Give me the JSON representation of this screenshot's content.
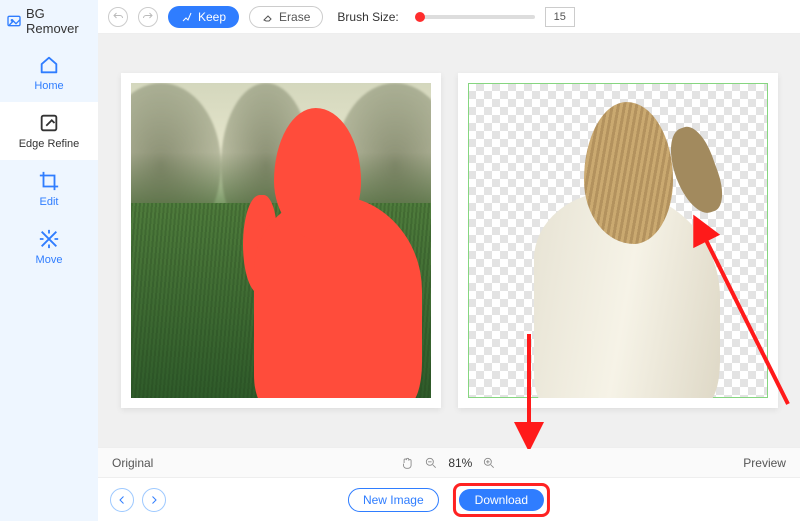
{
  "brand": "BG Remover",
  "sidebar": {
    "items": [
      {
        "label": "Home"
      },
      {
        "label": "Edge Refine"
      },
      {
        "label": "Edit"
      },
      {
        "label": "Move"
      }
    ]
  },
  "toolbar": {
    "keep_label": "Keep",
    "erase_label": "Erase",
    "brush_label": "Brush Size:",
    "brush_value": "15"
  },
  "status": {
    "original": "Original",
    "zoom": "81%",
    "preview": "Preview"
  },
  "footer": {
    "new_image": "New Image",
    "download": "Download"
  }
}
